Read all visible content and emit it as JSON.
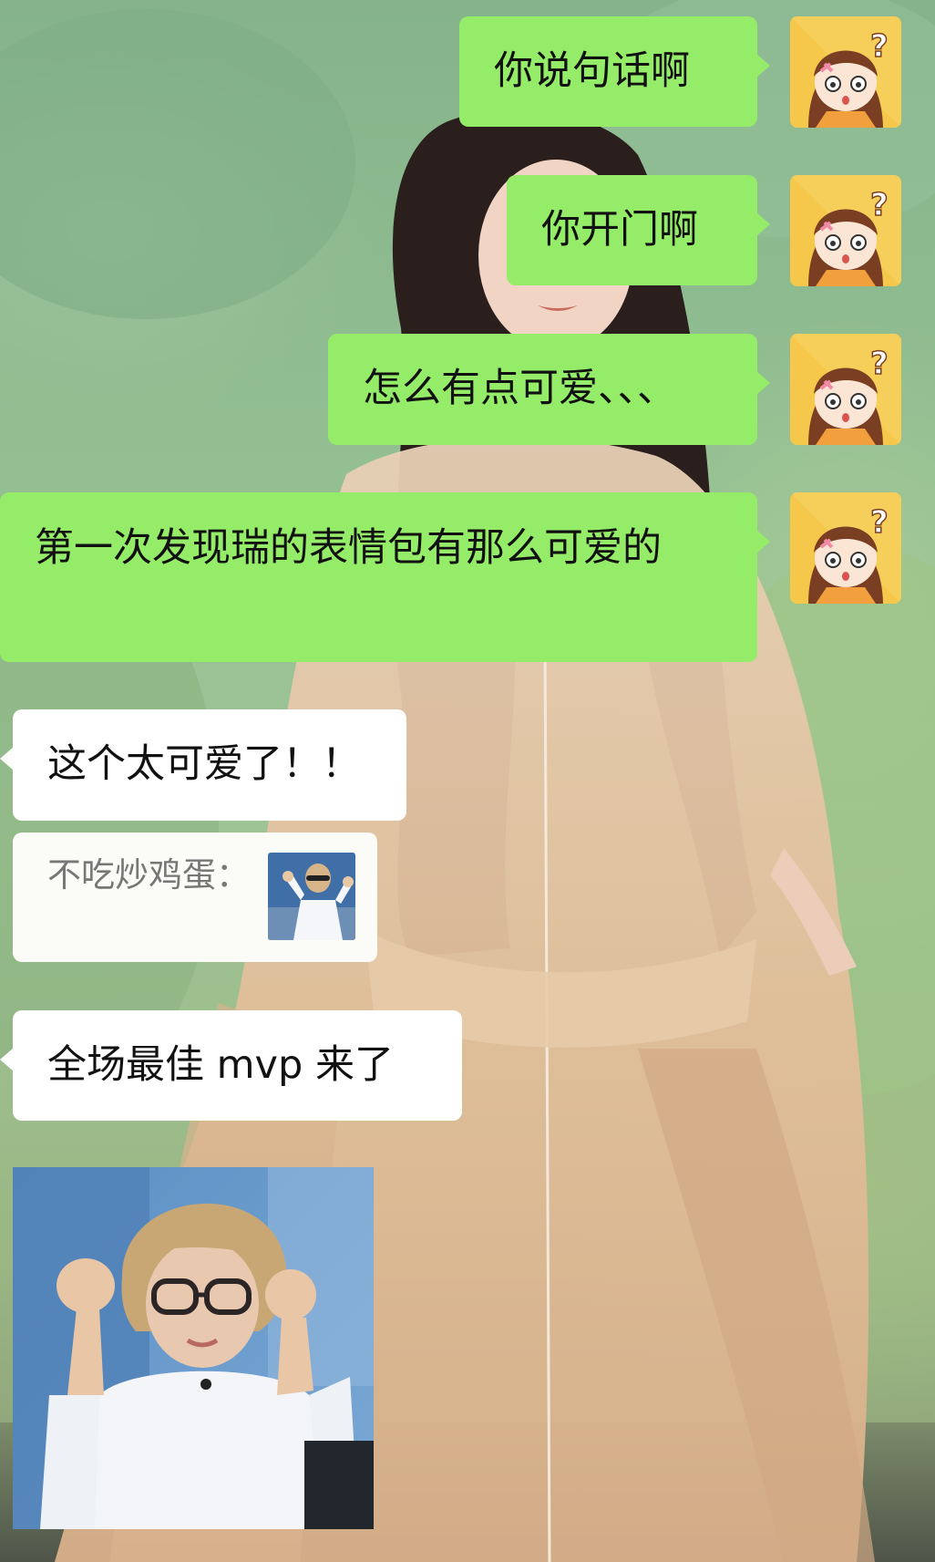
{
  "messages": {
    "sent": [
      {
        "text": "你说句话啊"
      },
      {
        "text": "你开门啊"
      },
      {
        "text": "怎么有点可爱、、、"
      },
      {
        "text": "第一次发现瑞的表情包有那么可爱的"
      }
    ],
    "received": [
      {
        "text": "这个太可爱了！！"
      },
      {
        "text": "全场最佳 mvp 来了"
      }
    ],
    "quote": {
      "sender": "不吃炒鸡蛋："
    }
  },
  "colors": {
    "sent_bubble": "#95ec69",
    "received_bubble": "#ffffff",
    "quote_text": "#777777"
  },
  "icons": [
    "user-avatar",
    "quoted-sticker-thumbnail",
    "sticker-image"
  ]
}
